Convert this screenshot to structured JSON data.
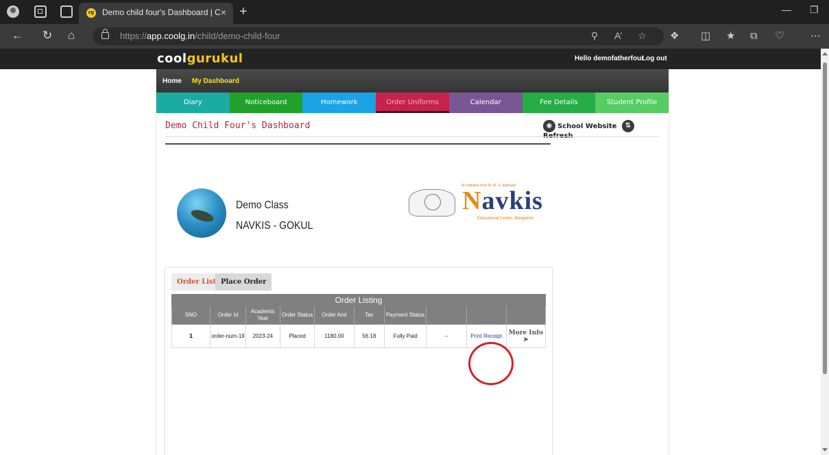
{
  "browser": {
    "tab_title": "Demo child four's Dashboard | C",
    "favicon": "cg",
    "tab_close": "×",
    "new_tab": "+",
    "url_prefix": "https://",
    "url_domain": "app.coolg.in",
    "url_path": "/child/demo-child-four"
  },
  "site": {
    "logo_cool": "cool",
    "logo_gurukul": "gurukul",
    "greeting": "Hello demofatherfour",
    "logout": "Log out"
  },
  "topnav": {
    "home": "Home",
    "dashboard": "My Dashboard"
  },
  "menu": [
    "Diary",
    "Noticeboard",
    "Homework",
    "Order Uniforms",
    "Calendar",
    "Fee Details",
    "Student Profile"
  ],
  "dashboard": {
    "title": "Demo Child Four's Dashboard",
    "school_website": "School Website",
    "refresh": "Refresh"
  },
  "student": {
    "class": "Demo Class",
    "school": "NAVKIS - GOKUL"
  },
  "brand": {
    "tagline_prefix": "An Initiative from",
    "tagline_name": "Dr. M. S. Ramaiah",
    "name_initial": "N",
    "name_rest": "avkis",
    "subtitle": "Educational Centre, Bangalore"
  },
  "orders": {
    "tab_list": "Order List",
    "tab_place": "Place Order",
    "caption": "Order Listing",
    "headers": [
      "SNO",
      "Order Id",
      "Academic Year",
      "Order Status",
      "Order Amt",
      "Tax",
      "Payment Status",
      "",
      "",
      ""
    ],
    "rows": [
      {
        "sno": "1",
        "order_id": "order-num-19",
        "academic_year": "2023-24",
        "status": "Placed",
        "amount": "1180.00",
        "tax": "56.18",
        "payment_status": "Fully Paid",
        "extra": "--",
        "print": "Print Receipt",
        "more": "More Info ➤"
      }
    ]
  },
  "colors": {
    "annotation_circle": "#d2222b",
    "dashboard_title": "#b5243a"
  }
}
